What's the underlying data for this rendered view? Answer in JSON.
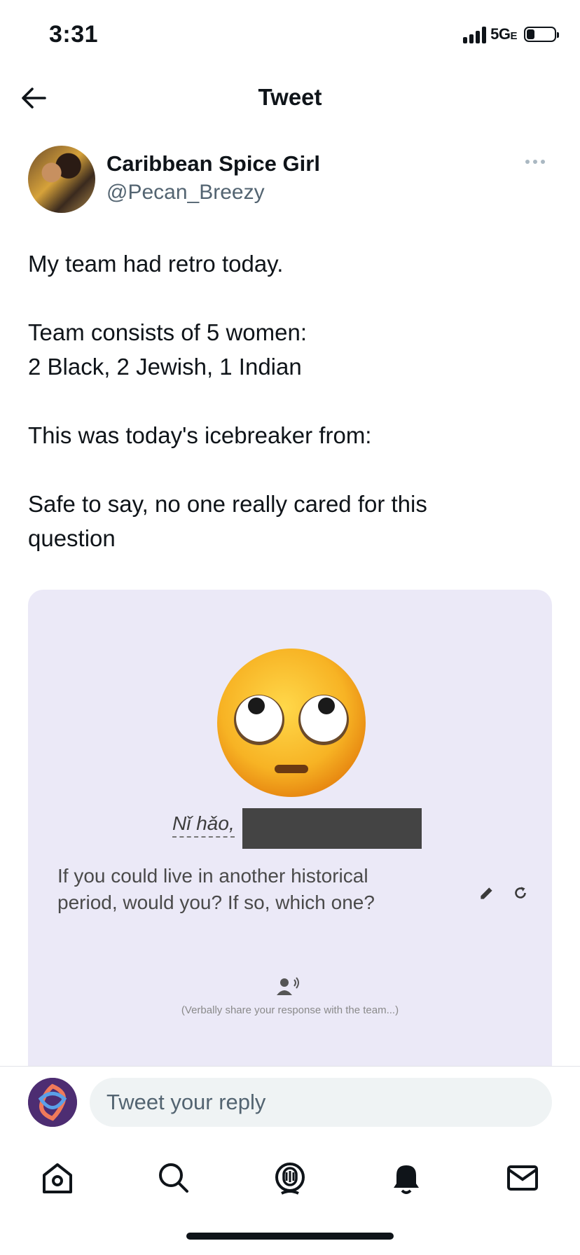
{
  "status_bar": {
    "time": "3:31",
    "network": "5G",
    "network_suffix": "E",
    "battery_level": 0.3
  },
  "header": {
    "title": "Tweet"
  },
  "tweet": {
    "author_name": "Caribbean Spice Girl",
    "author_handle": "@Pecan_Breezy",
    "text_lines": [
      "My team had retro today.",
      "",
      "Team consists of 5 women:",
      "2 Black, 2 Jewish, 1 Indian",
      "",
      "This was today's icebreaker from:",
      "",
      "Safe to say, no one really cared for this question"
    ],
    "text": {
      "line1": "My team had retro today.",
      "line2": "Team consists of 5 women:",
      "line3": "2 Black, 2 Jewish, 1 Indian",
      "line4": "This was today's icebreaker from:",
      "line5a": "Safe to say, no one really cared for this",
      "line5b": "question"
    }
  },
  "media": {
    "greeting": "Nǐ hǎo,",
    "question_line1": "If you could live in another historical",
    "question_line2": "period, would you? If so, which one?",
    "hint": "(Verbally share your response with the team...)"
  },
  "reply": {
    "placeholder": "Tweet your reply"
  },
  "tabs": [
    "home-icon",
    "search-icon",
    "spaces-icon",
    "notifications-icon",
    "messages-icon"
  ]
}
